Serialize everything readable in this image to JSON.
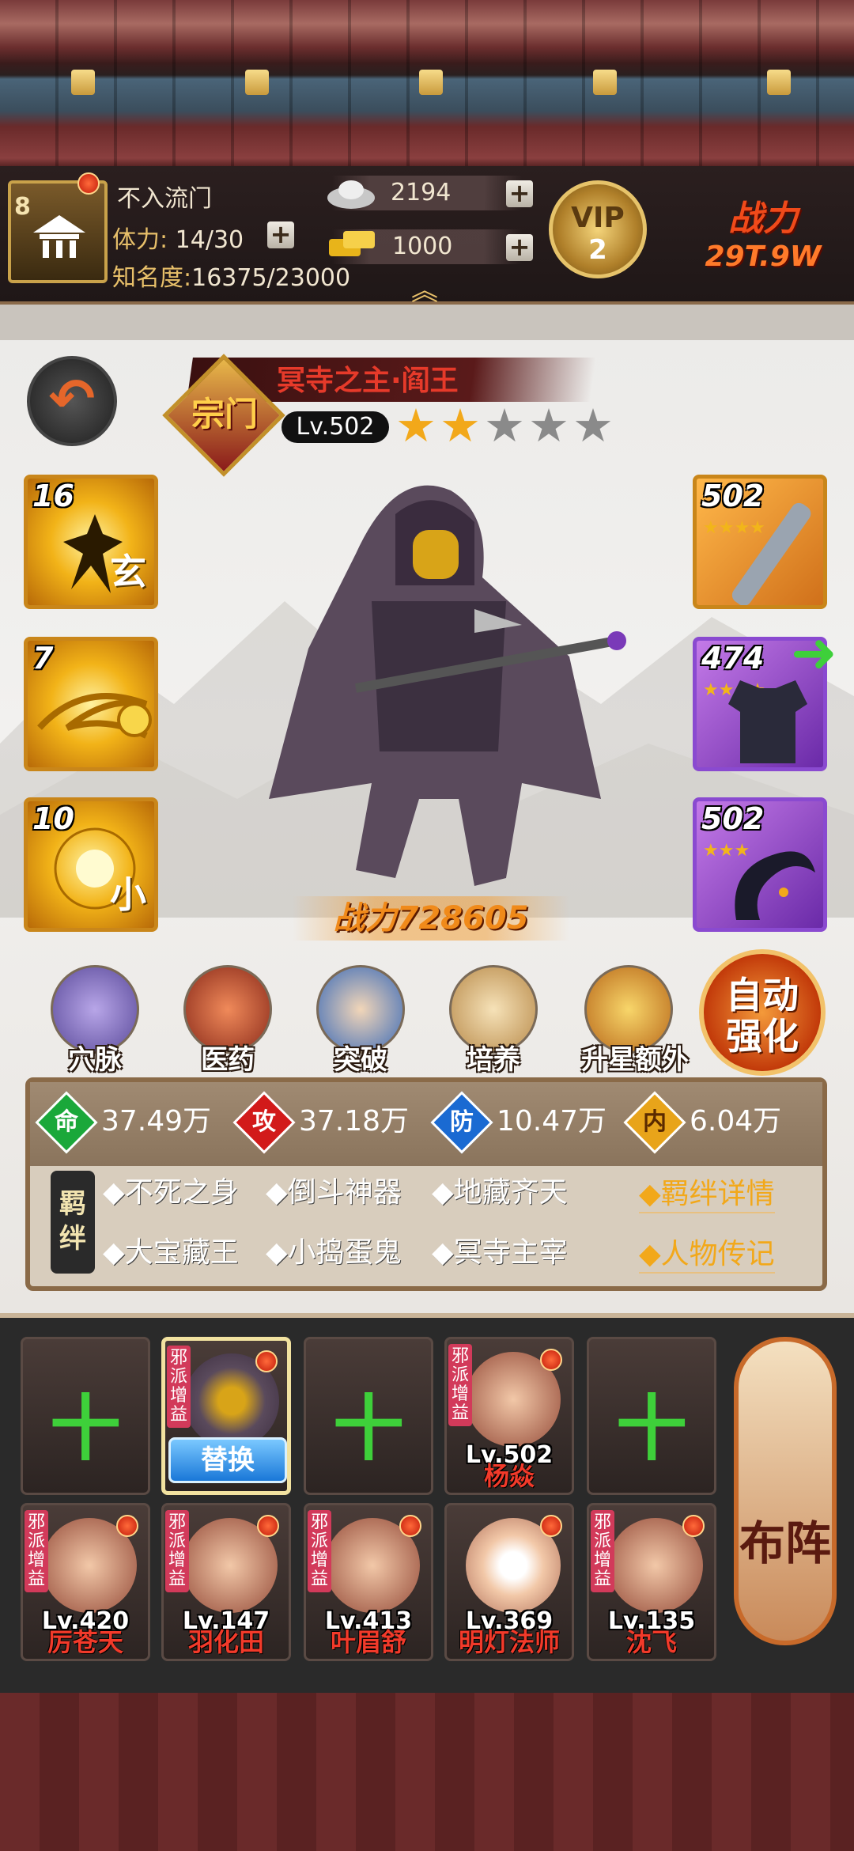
{
  "header": {
    "player_level": "8",
    "player_name": "不入流门",
    "stamina_label": "体力:",
    "stamina_value": "14/30",
    "fame_label": "知名度:",
    "fame_value": "16375/23000",
    "silver": "2194",
    "gold": "1000",
    "plus": "+",
    "vip_label": "VIP",
    "vip_level": "2",
    "power_label": "战力",
    "power_value": "29T.9W",
    "collapse": "︽"
  },
  "hero": {
    "badge": "宗门",
    "name": "冥寺之主·阎王",
    "level": "Lv.502",
    "stars_filled": 2,
    "stars_total": 5,
    "power_text": "战力728605"
  },
  "skills": [
    {
      "level": "16",
      "char": "玄"
    },
    {
      "level": "7",
      "char": ""
    },
    {
      "level": "10",
      "char": "小"
    }
  ],
  "equipment": [
    {
      "level": "502",
      "stars": 4
    },
    {
      "level": "474",
      "stars": 4
    },
    {
      "level": "502",
      "stars": 3
    }
  ],
  "functions": [
    {
      "label": "穴脉",
      "icon": "meridian-icon"
    },
    {
      "label": "医药",
      "icon": "medicine-icon"
    },
    {
      "label": "突破",
      "icon": "breakthrough-icon"
    },
    {
      "label": "培养",
      "icon": "cultivate-icon"
    },
    {
      "label": "升星额外",
      "icon": "star-up-icon"
    }
  ],
  "auto_button": {
    "line1": "自动",
    "line2": "强化"
  },
  "stats": [
    {
      "tag": "命",
      "value": "37.49万",
      "color": "#1aa83a"
    },
    {
      "tag": "攻",
      "value": "37.18万",
      "color": "#d21a1a"
    },
    {
      "tag": "防",
      "value": "10.47万",
      "color": "#1a6ad2"
    },
    {
      "tag": "内",
      "value": "6.04万",
      "color": "#e8a41a"
    }
  ],
  "bonds": {
    "tag": "羁绊",
    "row1": [
      "◆不死之身",
      "◆倒斗神器",
      "◆地藏齐天"
    ],
    "row2": [
      "◆大宝藏王",
      "◆小捣蛋鬼",
      "◆冥寺主宰"
    ],
    "detail_link": "◆羁绊详情",
    "bio_link": "◆人物传记"
  },
  "lineup": {
    "row1": [
      {
        "type": "empty"
      },
      {
        "type": "selected",
        "tag": "邪派增益",
        "swap": "替换"
      },
      {
        "type": "empty"
      },
      {
        "type": "hero",
        "tag": "邪派增益",
        "level": "Lv.502",
        "name": "杨焱"
      },
      {
        "type": "empty"
      }
    ],
    "row2": [
      {
        "tag": "邪派增益",
        "level": "Lv.420",
        "name": "厉苍天"
      },
      {
        "tag": "邪派增益",
        "level": "Lv.147",
        "name": "羽化田"
      },
      {
        "tag": "邪派增益",
        "level": "Lv.413",
        "name": "叶眉舒"
      },
      {
        "tag": "",
        "level": "Lv.369",
        "name": "明灯法师"
      },
      {
        "tag": "邪派增益",
        "level": "Lv.135",
        "name": "沈飞"
      }
    ],
    "formation_label": "布阵",
    "empty_symbol": "十"
  }
}
